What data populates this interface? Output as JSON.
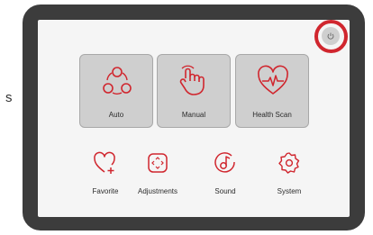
{
  "outside": {
    "marker": "s"
  },
  "colors": {
    "accent": "#d0262e",
    "bezel": "#3c3c3c",
    "screen": "#f5f5f5",
    "tile": "#cfcfcf"
  },
  "power": {
    "icon": "power-icon"
  },
  "modes": [
    {
      "label": "Auto",
      "icon": "auto-icon"
    },
    {
      "label": "Manual",
      "icon": "hand-icon"
    },
    {
      "label": "Health Scan",
      "icon": "heart-pulse-icon"
    }
  ],
  "functions": [
    {
      "label": "Favorite",
      "icon": "heart-plus-icon"
    },
    {
      "label": "Adjustments",
      "icon": "adjust-icon"
    },
    {
      "label": "Sound",
      "icon": "music-note-icon"
    },
    {
      "label": "System",
      "icon": "gear-icon"
    }
  ]
}
